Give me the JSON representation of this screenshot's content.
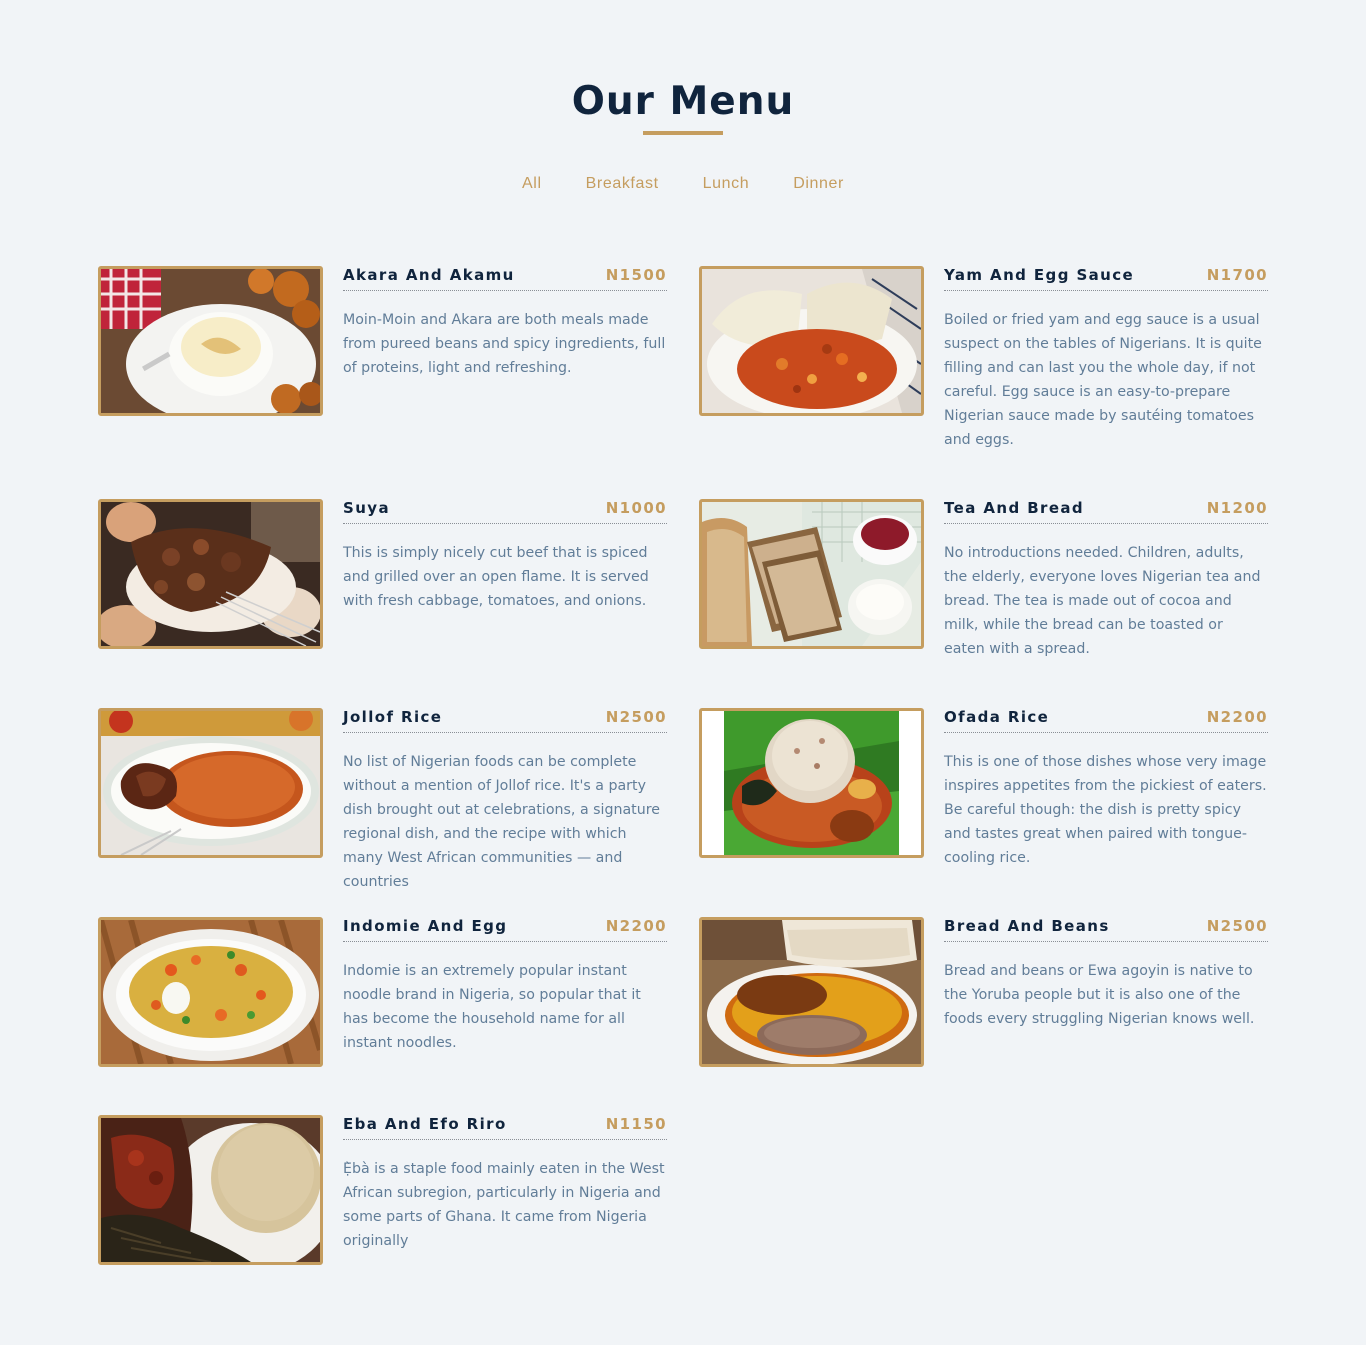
{
  "title": "Our Menu",
  "filters": [
    "All",
    "Breakfast",
    "Lunch",
    "Dinner"
  ],
  "colors": {
    "background": "#f1f4f7",
    "title": "#10243d",
    "accent": "#c59d5f",
    "text": "#617d98"
  },
  "items": [
    {
      "name": "Akara And Akamu",
      "price": "N1500",
      "description": "Moin-Moin and Akara are both meals made from pureed beans and spicy ingredients, full of proteins, light and refreshing."
    },
    {
      "name": "Yam And Egg Sauce",
      "price": "N1700",
      "description": "Boiled or fried yam and egg sauce is a usual suspect on the tables of Nigerians. It is quite filling and can last you the whole day, if not careful. Egg sauce is an easy-to-prepare Nigerian sauce made by sautéing tomatoes and eggs."
    },
    {
      "name": "Suya",
      "price": "N1000",
      "description": "This is simply nicely cut beef that is spiced and grilled over an open flame. It is served with fresh cabbage, tomatoes, and onions."
    },
    {
      "name": "Tea And Bread",
      "price": "N1200",
      "description": "No introductions needed. Children, adults, the elderly, everyone loves Nigerian tea and bread. The tea is made out of cocoa and milk, while the bread can be toasted or eaten with a spread."
    },
    {
      "name": "Jollof Rice",
      "price": "N2500",
      "description": "No list of Nigerian foods can be complete without a mention of Jollof rice. It's a party dish brought out at celebrations, a signature regional dish, and the recipe with which many West African communities — and countries"
    },
    {
      "name": "Ofada Rice",
      "price": "N2200",
      "description": "This is one of those dishes whose very image inspires appetites from the pickiest of eaters. Be careful though: the dish is pretty spicy and tastes great when paired with tongue-cooling rice."
    },
    {
      "name": "Indomie And Egg",
      "price": "N2200",
      "description": "Indomie is an extremely popular instant noodle brand in Nigeria, so popular that it has become the household name for all instant noodles."
    },
    {
      "name": "Bread And Beans",
      "price": "N2500",
      "description": "Bread and beans or Ewa agoyin is native to the Yoruba people but it is also one of the foods every struggling Nigerian knows well."
    },
    {
      "name": "Eba And Efo Riro",
      "price": "N1150",
      "description": "Ẹ̀bà is a staple food mainly eaten in the West African subregion, particularly in Nigeria and some parts of Ghana. It came from Nigeria originally"
    }
  ]
}
